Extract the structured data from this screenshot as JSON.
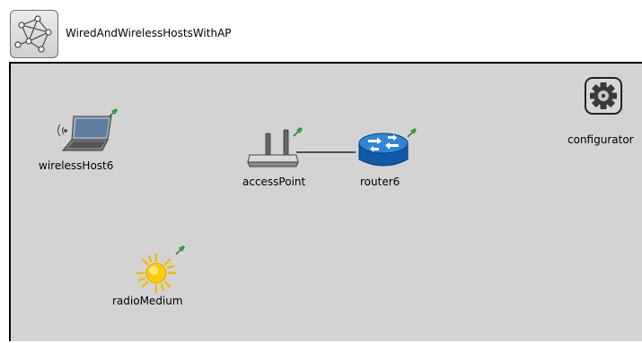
{
  "network": {
    "title": "WiredAndWirelessHostsWithAP",
    "icon": "network-graph-icon"
  },
  "nodes": {
    "wireless_host": {
      "label": "wirelessHost6",
      "icon": "laptop-icon"
    },
    "access_point": {
      "label": "accessPoint",
      "icon": "wireless-access-point-icon"
    },
    "router": {
      "label": "router6",
      "icon": "router-icon"
    },
    "configurator": {
      "label": "configurator",
      "icon": "gear-icon"
    },
    "radio_medium": {
      "label": "radioMedium",
      "icon": "sun-icon"
    }
  },
  "connections": [
    {
      "from": "accessPoint",
      "to": "router6"
    }
  ],
  "colors": {
    "canvas_bg": "#d3d3d3",
    "router_blue": "#1a6fc4",
    "pin_green": "#2e9e3a",
    "sun_yellow": "#ffcc00"
  }
}
